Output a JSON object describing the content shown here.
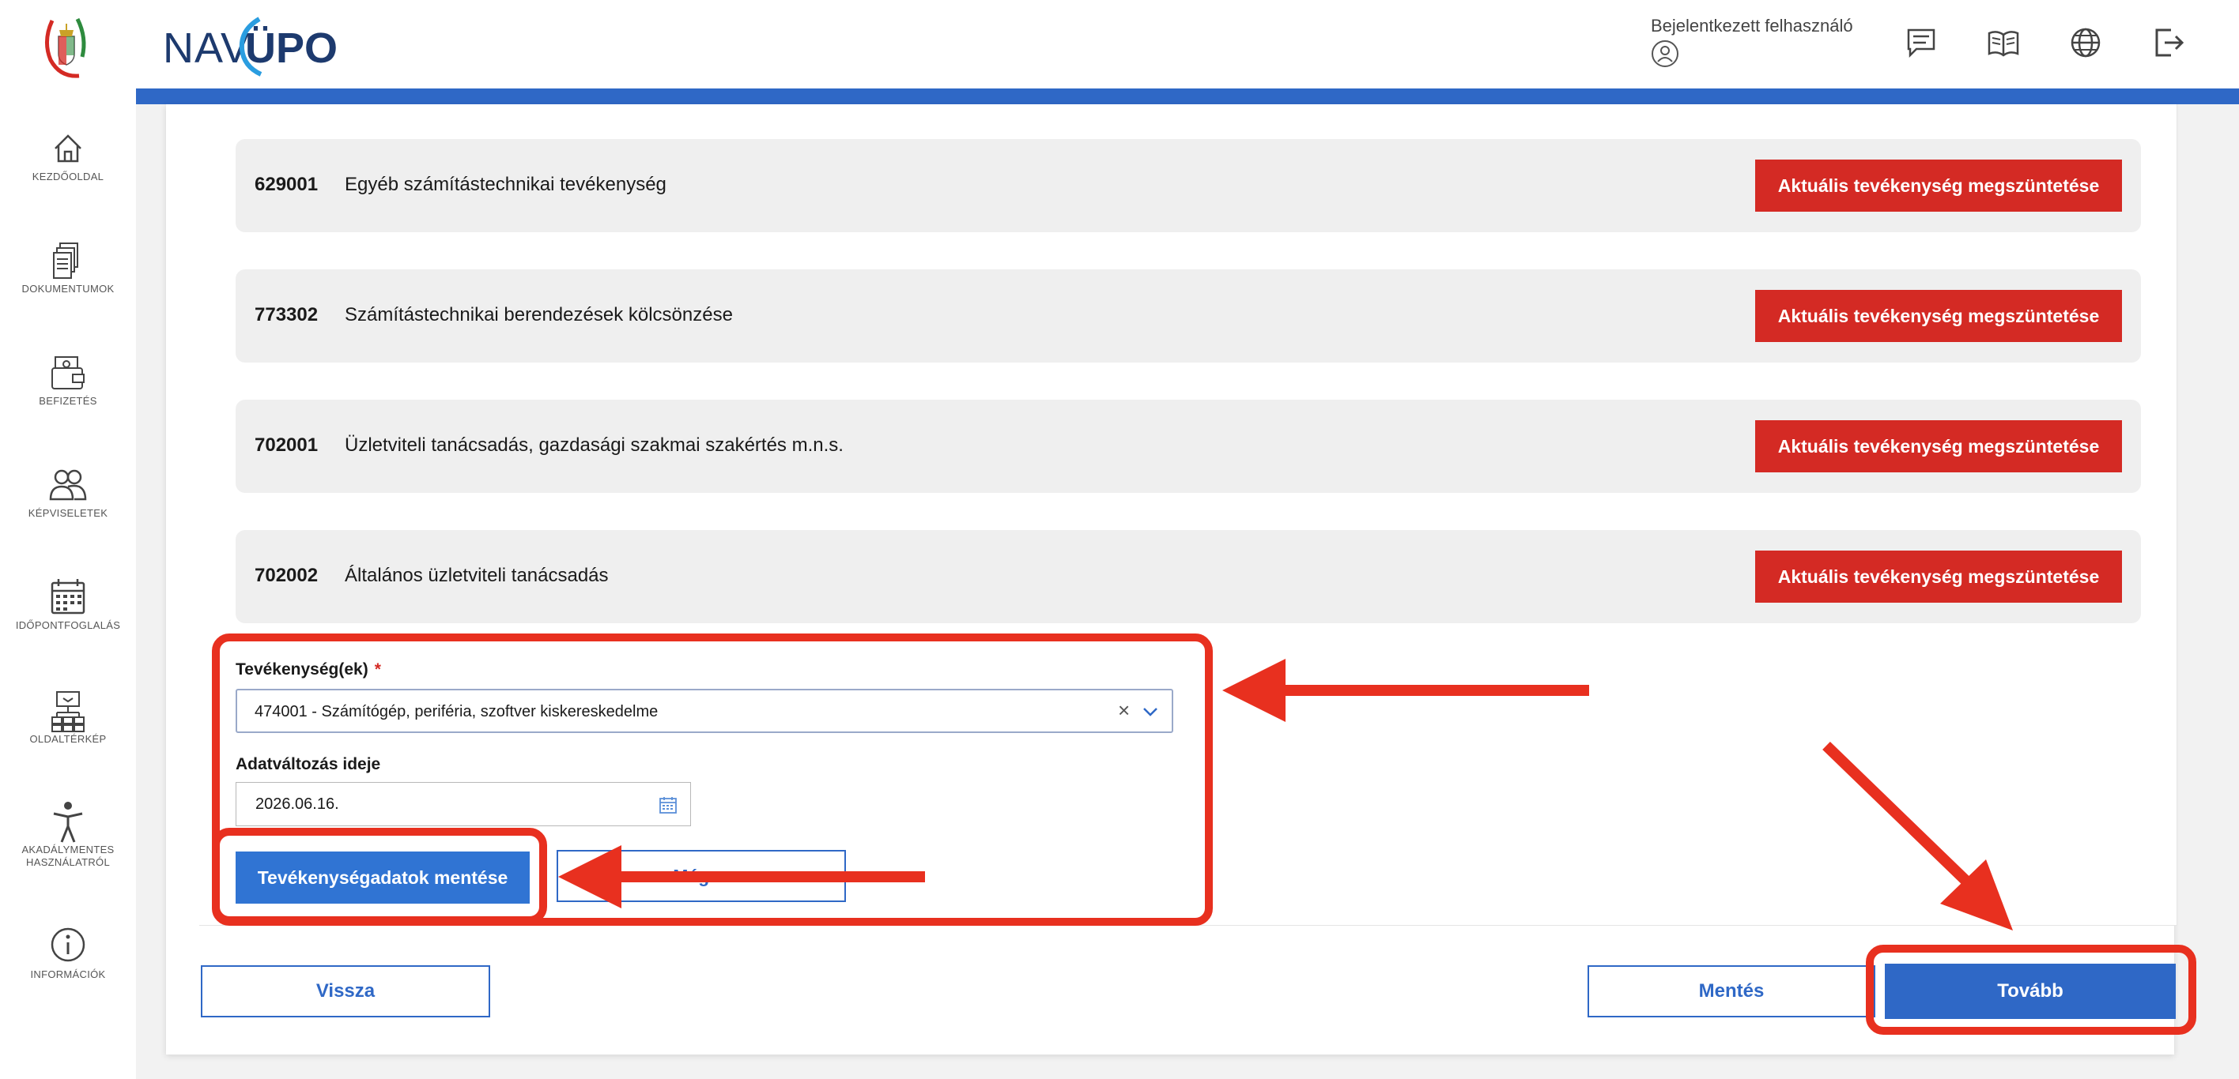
{
  "colors": {
    "primary_blue": "#2f68c6",
    "danger_red": "#d42a24",
    "annotation_red": "#e8301f",
    "logo_navy": "#1d3a6e"
  },
  "header": {
    "logo_nav": "NAV",
    "logo_upo": "ÜPO",
    "user_label": "Bejelentkezett felhasználó",
    "icons": [
      "message-icon",
      "book-icon",
      "globe-icon",
      "logout-icon"
    ]
  },
  "sidebar": {
    "items": [
      {
        "label": "KEZDŐOLDAL",
        "icon": "home-icon"
      },
      {
        "label": "DOKUMENTUMOK",
        "icon": "documents-icon"
      },
      {
        "label": "BEFIZETÉS",
        "icon": "payment-icon"
      },
      {
        "label": "KÉPVISELETEK",
        "icon": "people-icon"
      },
      {
        "label": "IDŐPONTFOGLALÁS",
        "icon": "calendar-icon"
      },
      {
        "label": "OLDALTÉRKÉP",
        "icon": "sitemap-icon"
      },
      {
        "label": "AKADÁLYMENTES",
        "label2": "HASZNÁLATRÓL",
        "icon": "accessibility-icon"
      },
      {
        "label": "INFORMÁCIÓK",
        "icon": "info-icon"
      }
    ]
  },
  "activities": [
    {
      "code": "629001",
      "name": "Egyéb számítástechnikai tevékenység",
      "button": "Aktuális tevékenység megszüntetése"
    },
    {
      "code": "773302",
      "name": "Számítástechnikai berendezések kölcsönzése",
      "button": "Aktuális tevékenység megszüntetése"
    },
    {
      "code": "702001",
      "name": "Üzletviteli tanácsadás, gazdasági szakmai szakértés m.n.s.",
      "button": "Aktuális tevékenység megszüntetése"
    },
    {
      "code": "702002",
      "name": "Általános üzletviteli tanácsadás",
      "button": "Aktuális tevékenység megszüntetése"
    }
  ],
  "form": {
    "activity_label": "Tevékenység(ek)",
    "required_mark": "*",
    "activity_value": "474001 - Számítógép, periféria, szoftver kiskereskedelme",
    "clear_glyph": "×",
    "date_label": "Adatváltozás ideje",
    "date_value": "2026.06.16.",
    "save_activity_button": "Tevékenységadatok mentése",
    "cancel_activity_button": "Mégse"
  },
  "footer": {
    "back_button": "Vissza",
    "save_button": "Mentés",
    "next_button": "Tovább"
  }
}
